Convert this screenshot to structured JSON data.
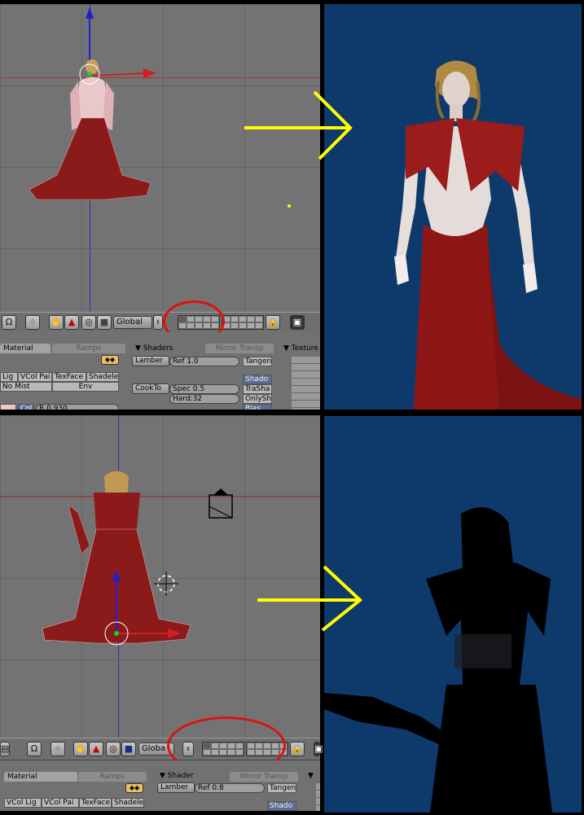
{
  "top": {
    "toolbar": {
      "magnet": "Ω",
      "orientation": "Global",
      "lock": "🔒"
    },
    "buttons_window": {
      "tabs": [
        "Material",
        "Ramps"
      ],
      "shaders_panel": "Shaders",
      "shaders_tabs": [
        "Mirror Transp"
      ],
      "textures_panel": "Texture",
      "row1": [
        "Lig",
        "VCol Pai",
        "TexFace",
        "Shadele"
      ],
      "row2": [
        "No Mist",
        "Env"
      ],
      "lambert": "Lamber",
      "ref": "Ref   1.0",
      "tangent": "Tangen",
      "cooktorr": "CookTo",
      "spec": "Spec 0.5",
      "hard": "Hard:32",
      "shadow_buttons": [
        "Shado",
        "TraSha",
        "OnlySh",
        "Bias"
      ],
      "col_label": "Col",
      "col_value": "R 0.930"
    }
  },
  "bottom": {
    "toolbar": {
      "magnet": "Ω",
      "orientation": "Globa",
      "lock": "🔒"
    },
    "buttons_window": {
      "tabs": [
        "Material",
        "Ramps"
      ],
      "shaders_panel": "Shader",
      "shaders_tabs": [
        "Mirror Transp"
      ],
      "row1": [
        "VCol Lig",
        "VCol Pai",
        "TexFace",
        "Shadele"
      ],
      "lambert": "Lamber",
      "ref": "Ref   0.8",
      "tangent": "Tangen",
      "shadow": "Shado"
    }
  },
  "colors": {
    "viewport_bg": "#737373",
    "render_bg": "#0d3a6b",
    "annotation_arrow": "#ffff00",
    "annotation_circle": "#e01010",
    "dress": "#8b1a1a"
  }
}
